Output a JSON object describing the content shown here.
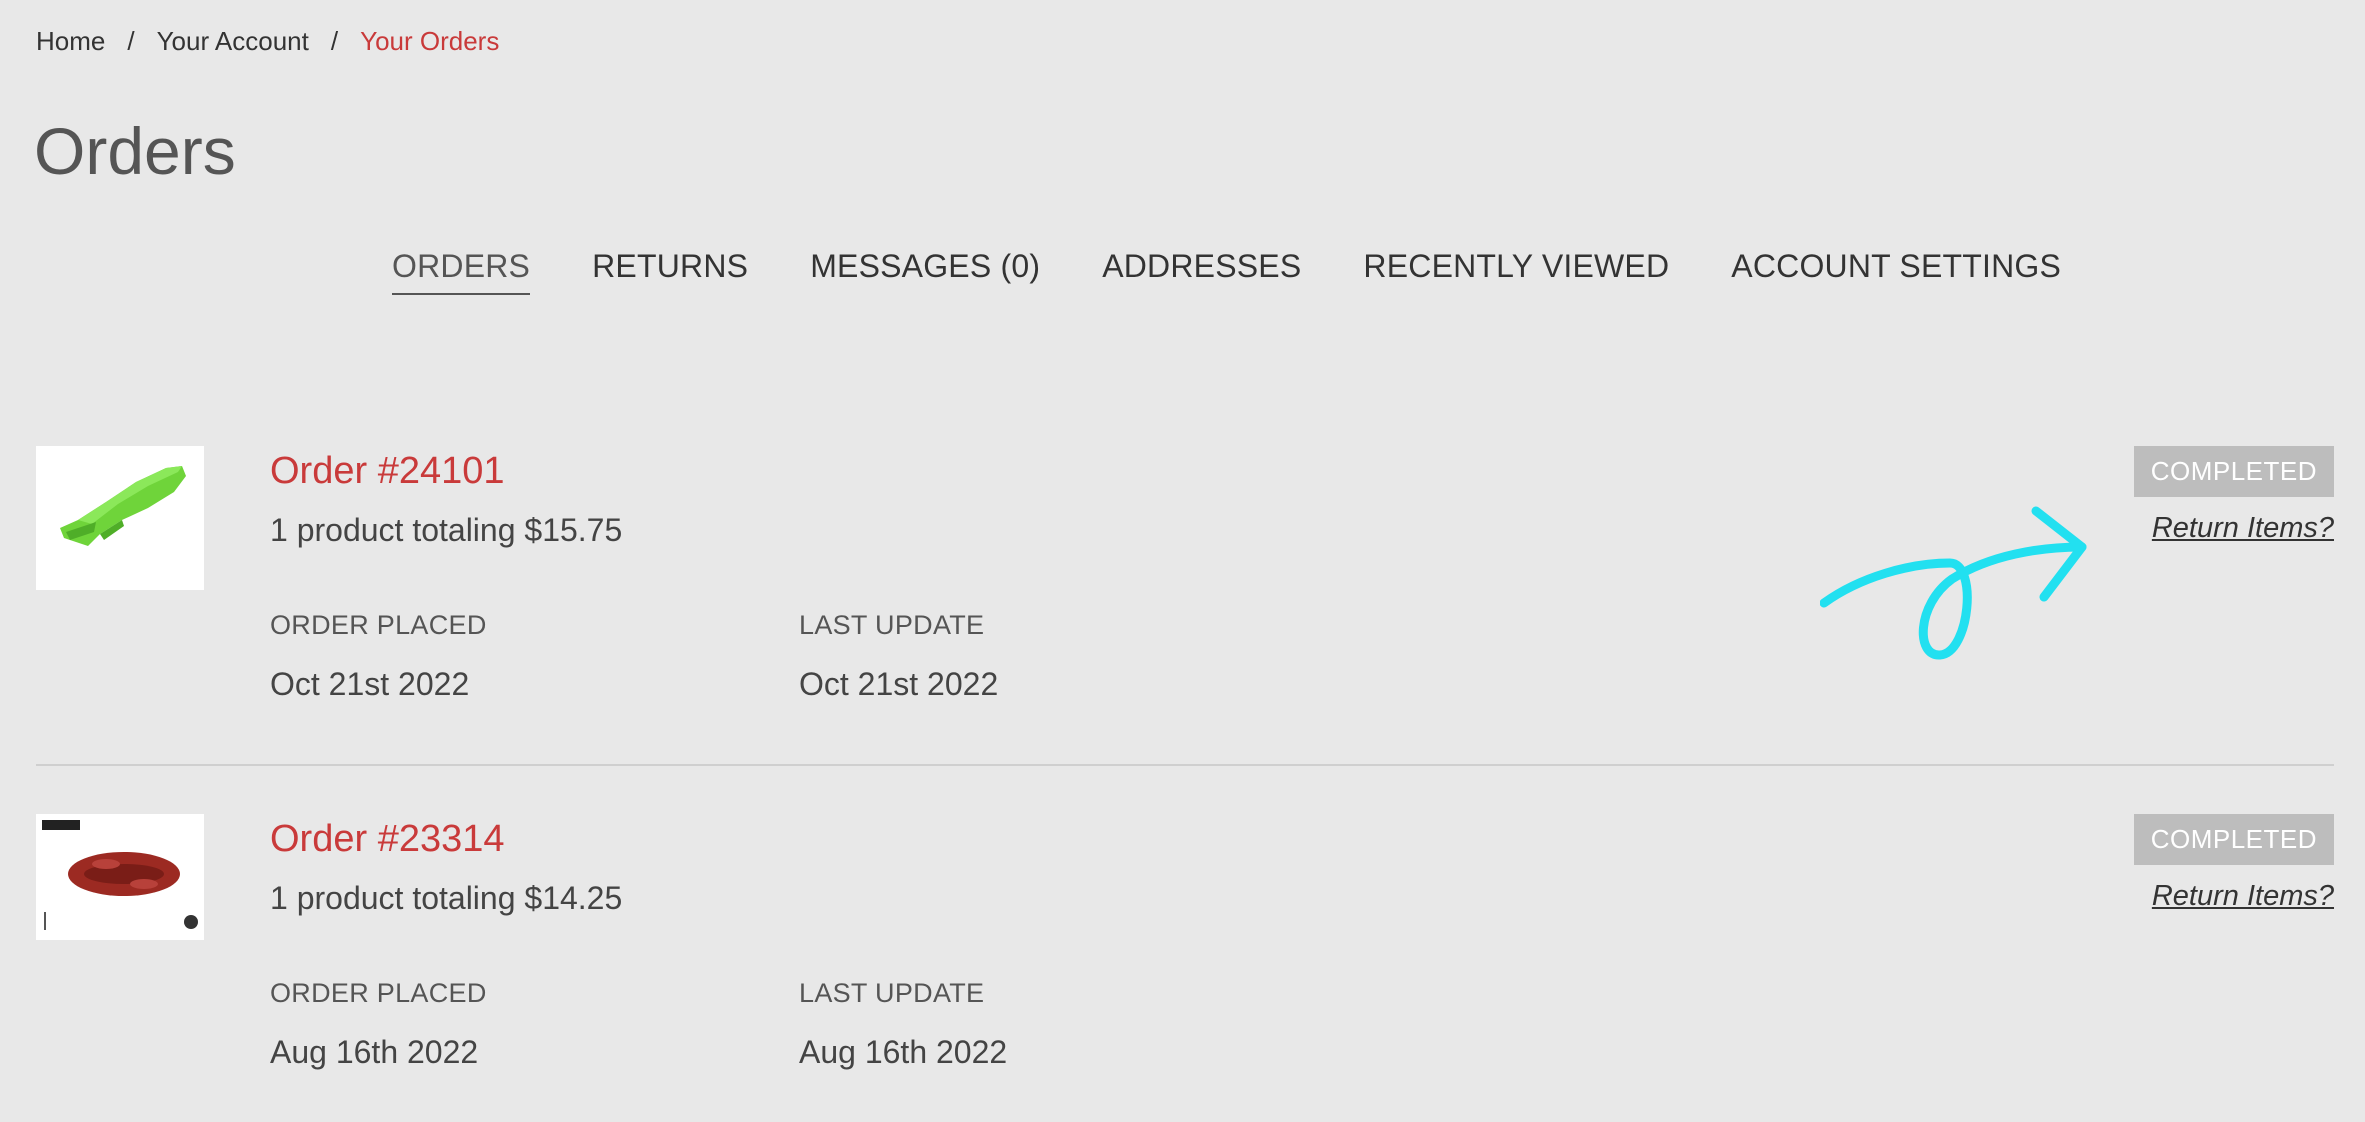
{
  "breadcrumb": {
    "home": "Home",
    "separator": "/",
    "account": "Your Account",
    "current": "Your Orders"
  },
  "page_title": "Orders",
  "tabs": [
    {
      "label": "ORDERS",
      "active": true
    },
    {
      "label": "RETURNS",
      "active": false
    },
    {
      "label": "MESSAGES (0)",
      "active": false
    },
    {
      "label": "ADDRESSES",
      "active": false
    },
    {
      "label": "RECENTLY VIEWED",
      "active": false
    },
    {
      "label": "ACCOUNT SETTINGS",
      "active": false
    }
  ],
  "orders": [
    {
      "title": "Order #24101",
      "summary": "1 product totaling $15.75",
      "placed_label": "ORDER PLACED",
      "placed_value": "Oct 21st 2022",
      "update_label": "LAST UPDATE",
      "update_value": "Oct 21st 2022",
      "status": "COMPLETED",
      "return_link": "Return Items?",
      "thumbnail_icon": "green-fender-product-icon"
    },
    {
      "title": "Order #23314",
      "summary": "1 product totaling $14.25",
      "placed_label": "ORDER PLACED",
      "placed_value": "Aug 16th 2022",
      "update_label": "LAST UPDATE",
      "update_value": "Aug 16th 2022",
      "status": "COMPLETED",
      "return_link": "Return Items?",
      "thumbnail_icon": "red-chain-product-icon"
    }
  ],
  "colors": {
    "background": "#e8e8e8",
    "accent_red": "#c93a3a",
    "badge_gray": "#bdbdbd",
    "annotation_cyan": "#22e0f0",
    "product_green": "#6fd43a",
    "product_red": "#9c2a22"
  },
  "annotation": {
    "icon": "cyan-hand-drawn-arrow-icon"
  }
}
